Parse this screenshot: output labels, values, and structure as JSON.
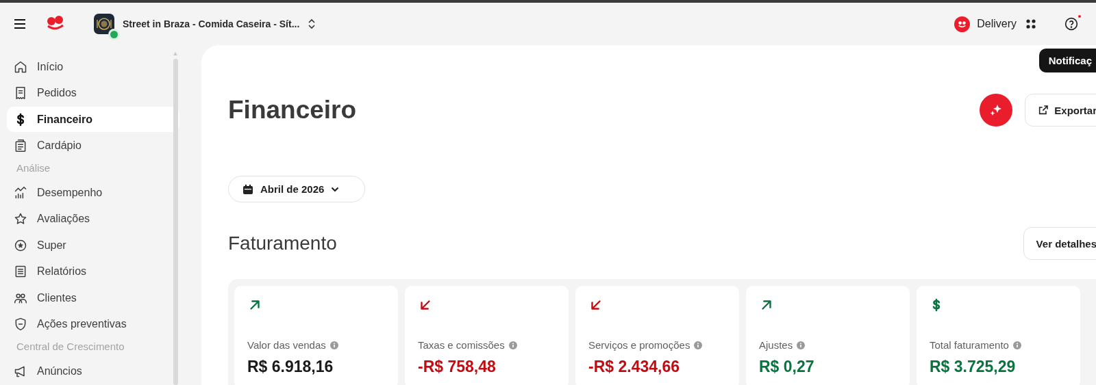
{
  "header": {
    "restaurant": "Street in Braza - Comida Caseira - Sít...",
    "online": true,
    "product": "Delivery",
    "help_badge": true
  },
  "tooltip": "Notificaç",
  "sidebar": [
    {
      "kind": "item",
      "label": "Início",
      "selected": false
    },
    {
      "kind": "item",
      "label": "Pedidos",
      "selected": false
    },
    {
      "kind": "item",
      "label": "Financeiro",
      "selected": true
    },
    {
      "kind": "item",
      "label": "Cardápio",
      "selected": false
    },
    {
      "kind": "heading",
      "label": "Análise"
    },
    {
      "kind": "item",
      "label": "Desempenho",
      "selected": false
    },
    {
      "kind": "item",
      "label": "Avaliações",
      "selected": false
    },
    {
      "kind": "item",
      "label": "Super",
      "selected": false
    },
    {
      "kind": "item",
      "label": "Relatórios",
      "selected": false
    },
    {
      "kind": "item",
      "label": "Clientes",
      "selected": false
    },
    {
      "kind": "item",
      "label": "Ações preventivas",
      "selected": false
    },
    {
      "kind": "heading",
      "label": "Central de Crescimento"
    },
    {
      "kind": "item",
      "label": "Anúncios",
      "selected": false
    }
  ],
  "page": {
    "title": "Financeiro",
    "export_button": "Exportar",
    "period": "Abril de 2026",
    "section_title": "Faturamento",
    "details_button": "Ver detalhes"
  },
  "cards": [
    {
      "kind": "up",
      "label": "Valor das vendas",
      "value": "R$ 6.918,16",
      "color": "#1a1a1a"
    },
    {
      "kind": "down",
      "label": "Taxas e comissões",
      "value": "-R$ 758,48",
      "color": "#c30c12"
    },
    {
      "kind": "down",
      "label": "Serviços e promoções",
      "value": "-R$ 2.434,66",
      "color": "#c30c12"
    },
    {
      "kind": "up",
      "label": "Ajustes",
      "value": "R$ 0,27",
      "color": "#08743f"
    },
    {
      "kind": "total",
      "label": "Total faturamento",
      "value": "R$ 3.725,29",
      "color": "#08743f"
    }
  ]
}
